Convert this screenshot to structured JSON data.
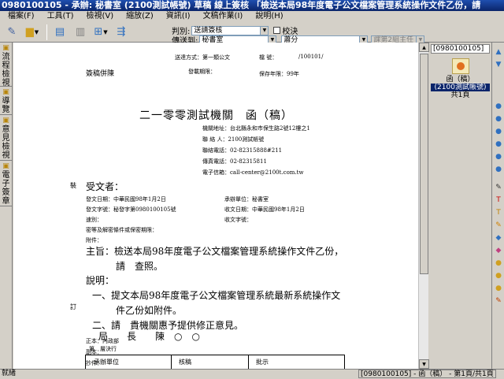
{
  "window": {
    "title": "0980100105 - 承辦: 秘書室 (2100測試帳號)  草稿 線上簽核 「檢送本局98年度電子公文檔案管理系統操作文件乙份，請"
  },
  "menu": [
    "檔案(F)",
    "工具(T)",
    "檢視(V)",
    "縮放(Z)",
    "資訊(I)",
    "文稿作業(I)",
    "說明(H)"
  ],
  "toolbar": {
    "print_category_label": "判別:",
    "print_category_value": "送請簽核",
    "attach_label": "校決",
    "send_label": "傳送到:",
    "send_value": "秘書室",
    "send_to_value": "蕭分",
    "disabled_value": "課第2組主任"
  },
  "left_tabs": [
    {
      "icon": "▣",
      "label": "流程檢視"
    },
    {
      "icon": "▣",
      "label": "導覽"
    },
    {
      "icon": "▣",
      "label": "意見檢視"
    },
    {
      "icon": "▣",
      "label": "電子簽章"
    }
  ],
  "document": {
    "header_left": "送達方式：第一類公文",
    "header_code_label": "檔    號：",
    "header_code": "/100101/",
    "sign_left": "簽稿併陳",
    "publish_date_label": "發載期限：",
    "keep_years": "保存年限：99年",
    "agency_title": "二一零零測試機關　函（稿）",
    "info": [
      "機關地址：台北縣永和市保生路2號12樓之1",
      "聯 絡 人：2100測試帳號",
      "聯絡電話：02-82315888#211",
      "傳真電話：02-82315811",
      "電子信箱：call-center@2100t.com.tw"
    ],
    "receiver_label": "受文者：",
    "meta_left": [
      "發文日期：中華民國98年1月2日",
      "發文字號：秘發字第0980100105號",
      "速別：",
      "密等及解密條件或保密期限：",
      "附件："
    ],
    "meta_right": [
      "承辦單位：秘書室",
      "收文日期：中華民國98年1月2日",
      "收文字號："
    ],
    "subject_line1": "主旨：檢送本局98年度電子公文檔案管理系統操作文件乙份，",
    "subject_line2": "請　查照。",
    "desc_label": "說明：",
    "desc1_line1": "一、提文本局98年度電子公文檔案管理系統最新系統操作文",
    "desc1_line2": "件乙份如附件。",
    "desc2": "二、請　貴機關惠予提供修正意見。",
    "copies": [
      "正本：內政部",
      "副本：",
      "抄件："
    ],
    "signature": "局　　長　　陳　○　○",
    "stamp_label": "第　層決行",
    "table_headers": [
      "承辦單位",
      "核稿",
      "批示"
    ],
    "margin_chars": [
      "裝",
      "訂"
    ]
  },
  "right_panel": {
    "header": "[0980100105]",
    "item_label_1": "函（稿）",
    "item_label_2": "(2100測試帳號)",
    "item_label_3": "共1頁"
  },
  "right_tools": [
    "●",
    "●",
    "●",
    "●",
    "●",
    "✎",
    "T",
    "T",
    "✎",
    "◆",
    "◆",
    "●",
    "●",
    "●",
    "●",
    "●",
    "✎",
    "✎"
  ],
  "status": {
    "left": "就緒",
    "right": "[0980100105] - 函（稿） - 第1頁/共1頁"
  }
}
